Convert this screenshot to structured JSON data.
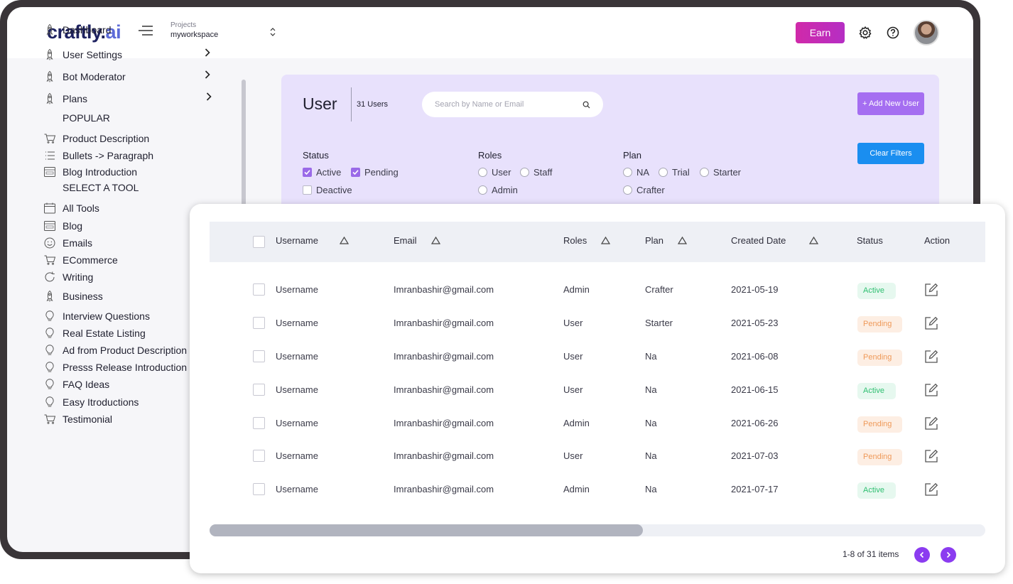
{
  "header": {
    "logo_main": "craftly.",
    "logo_accent": "ai",
    "project_label": "Projects",
    "project_name": "myworkspace",
    "earn_label": "Earn"
  },
  "sidebar": {
    "items": [
      {
        "label": "Dashboard",
        "icon": "rocket-icon"
      },
      {
        "label": "User Settings",
        "icon": "rocket-icon"
      },
      {
        "label": "Bot Moderator",
        "icon": "rocket-icon"
      },
      {
        "label": "Plans",
        "icon": "rocket-icon"
      },
      {
        "label": "Product Description",
        "icon": "cart-icon"
      },
      {
        "label": "Bullets -> Paragraph",
        "icon": "list-icon"
      },
      {
        "label": "Blog Introduction",
        "icon": "blog-icon"
      },
      {
        "label": "All Tools",
        "icon": "calendar-icon"
      },
      {
        "label": "Blog",
        "icon": "blog-icon"
      },
      {
        "label": "Emails",
        "icon": "smiley-icon"
      },
      {
        "label": "ECommerce",
        "icon": "cart-icon"
      },
      {
        "label": "Writing",
        "icon": "refresh-icon"
      },
      {
        "label": "Business",
        "icon": "rocket-icon"
      },
      {
        "label": "Interview Questions",
        "icon": "bulb-icon"
      },
      {
        "label": "Real Estate Listing",
        "icon": "bulb-icon"
      },
      {
        "label": "Ad from Product Description",
        "icon": "bulb-icon"
      },
      {
        "label": "Presss Release  Introduction",
        "icon": "bulb-icon"
      },
      {
        "label": "FAQ Ideas",
        "icon": "bulb-icon"
      },
      {
        "label": "Easy Itroductions",
        "icon": "bulb-icon"
      },
      {
        "label": "Testimonial",
        "icon": "cart-icon"
      }
    ],
    "section_popular": "POPULAR",
    "section_tool": "SELECT A TOOL"
  },
  "panel": {
    "title": "User",
    "count": "31 Users",
    "search_placeholder": "Search by Name or Email",
    "add_button": "+ Add New User",
    "clear_button": "Clear Filters",
    "status_heading": "Status",
    "status_options": [
      {
        "label": "Active",
        "checked": true
      },
      {
        "label": "Pending",
        "checked": true
      },
      {
        "label": "Deactive",
        "checked": false
      }
    ],
    "roles_heading": "Roles",
    "roles_options": [
      "User",
      "Staff",
      "Admin"
    ],
    "plan_heading": "Plan",
    "plan_options": [
      "NA",
      "Trial",
      "Starter",
      "Crafter"
    ]
  },
  "table": {
    "columns": [
      "Username",
      "Email",
      "Roles",
      "Plan",
      "Created Date",
      "Status",
      "Action"
    ],
    "rows": [
      {
        "username": "Username",
        "email": "Imranbashir@gmail.com",
        "role": "Admin",
        "plan": "Crafter",
        "date": "2021-05-19",
        "status": "Active"
      },
      {
        "username": "Username",
        "email": "Imranbashir@gmail.com",
        "role": "User",
        "plan": "Starter",
        "date": "2021-05-23",
        "status": "Pending"
      },
      {
        "username": "Username",
        "email": "Imranbashir@gmail.com",
        "role": "User",
        "plan": "Na",
        "date": "2021-06-08",
        "status": "Pending"
      },
      {
        "username": "Username",
        "email": "Imranbashir@gmail.com",
        "role": "User",
        "plan": "Na",
        "date": "2021-06-15",
        "status": "Active"
      },
      {
        "username": "Username",
        "email": "Imranbashir@gmail.com",
        "role": "Admin",
        "plan": "Na",
        "date": "2021-06-26",
        "status": "Pending"
      },
      {
        "username": "Username",
        "email": "Imranbashir@gmail.com",
        "role": "User",
        "plan": "Na",
        "date": "2021-07-03",
        "status": "Pending"
      },
      {
        "username": "Username",
        "email": "Imranbashir@gmail.com",
        "role": "Admin",
        "plan": "Na",
        "date": "2021-07-17",
        "status": "Active"
      }
    ],
    "pagination": "1-8 of 31 items"
  },
  "colors": {
    "accent": "#8b3cf0",
    "earn": "#c729b3",
    "panel_bg": "#e8e1fc",
    "active_text": "#2fbf71",
    "pending_text": "#ef9a5a"
  }
}
